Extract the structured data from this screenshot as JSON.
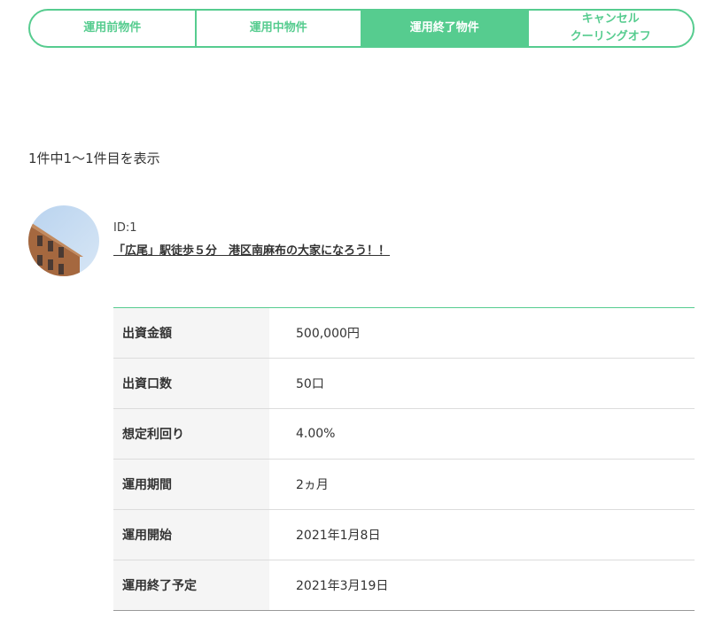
{
  "tabs": [
    {
      "label": "運用前物件",
      "active": false
    },
    {
      "label": "運用中物件",
      "active": false
    },
    {
      "label": "運用終了物件",
      "active": true
    },
    {
      "label_line1": "キャンセル",
      "label_line2": "クーリングオフ",
      "active": false
    }
  ],
  "count_text": "1件中1〜1件目を表示",
  "property": {
    "id_text": "ID:1",
    "title": "「広尾」駅徒歩５分　港区南麻布の大家になろう！！"
  },
  "details": [
    {
      "label": "出資金額",
      "value": "500,000円"
    },
    {
      "label": "出資口数",
      "value": "50口"
    },
    {
      "label": "想定利回り",
      "value": "4.00%"
    },
    {
      "label": "運用期間",
      "value": "2ヵ月"
    },
    {
      "label": "運用開始",
      "value": "2021年1月8日"
    },
    {
      "label": "運用終了予定",
      "value": "2021年3月19日"
    }
  ],
  "colors": {
    "accent": "#56cc8f",
    "label_bg": "#f5f5f5",
    "divider": "#dcdcdc"
  }
}
